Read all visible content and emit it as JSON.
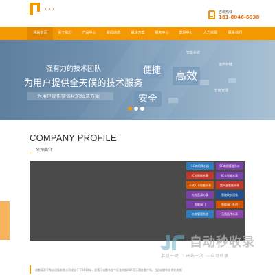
{
  "header": {
    "hotline_label": "咨询热线",
    "hotline_number": "181-8046-6938"
  },
  "nav": {
    "items": [
      "网站首页",
      "关于我们",
      "产品中心",
      "新闻动态",
      "解决方案",
      "服务中心",
      "案例中心",
      "人力资源",
      "联系我们"
    ],
    "active_index": 0
  },
  "banner": {
    "line1": "强有力的技术团队",
    "line2": "为用户提供全天候的技术服务",
    "line3": "为用户提供整体化的解决方案",
    "words": {
      "convenient": "便捷",
      "efficient": "高效",
      "secure": "安全",
      "smart_system": "智能系统",
      "cloud_storage": "运作存储",
      "smart_management": "智能管理"
    },
    "slide_count": 3,
    "active_slide": 0
  },
  "profile": {
    "title": "COMPANY PROFILE",
    "subtitle": "公司简介",
    "intro": "成都清源开净水设备有限公司成立于于2014年，坐落于成都市金牛区金府路886号万通金融广场，注册成都市金府机电城"
  },
  "tiles": [
    {
      "label": "5G商用净水器",
      "color": "#2e7bbf"
    },
    {
      "label": "5G商用管道净水",
      "color": "#7b3fa8"
    },
    {
      "label": "IC卡智能水表",
      "color": "#c0392b"
    },
    {
      "label": "IC卡智能水表",
      "color": "#7b3fa8"
    },
    {
      "label": "干式IC卡智能水表",
      "color": "#d35400"
    },
    {
      "label": "超声波智能水表",
      "color": "#c0392b"
    },
    {
      "label": "光电直读水表",
      "color": "#7b3fa8"
    },
    {
      "label": "智能饮水设备",
      "color": "#1f4f8f"
    },
    {
      "label": "智能阀门",
      "color": "#7b3fa8"
    },
    {
      "label": "智能阀门系列",
      "color": "#d35400"
    },
    {
      "label": "水务管理系统",
      "color": "#2e7bbf"
    },
    {
      "label": "无线远传水表",
      "color": "#8e44ad"
    }
  ],
  "watermark": {
    "name": "自动秒收录",
    "tagline": "上线一键 → 来访一次 → 自动收录"
  },
  "colors": {
    "brand_orange": "#f39800",
    "banner_blue": "#6f90ae",
    "media_dark": "#4a4a4a"
  }
}
